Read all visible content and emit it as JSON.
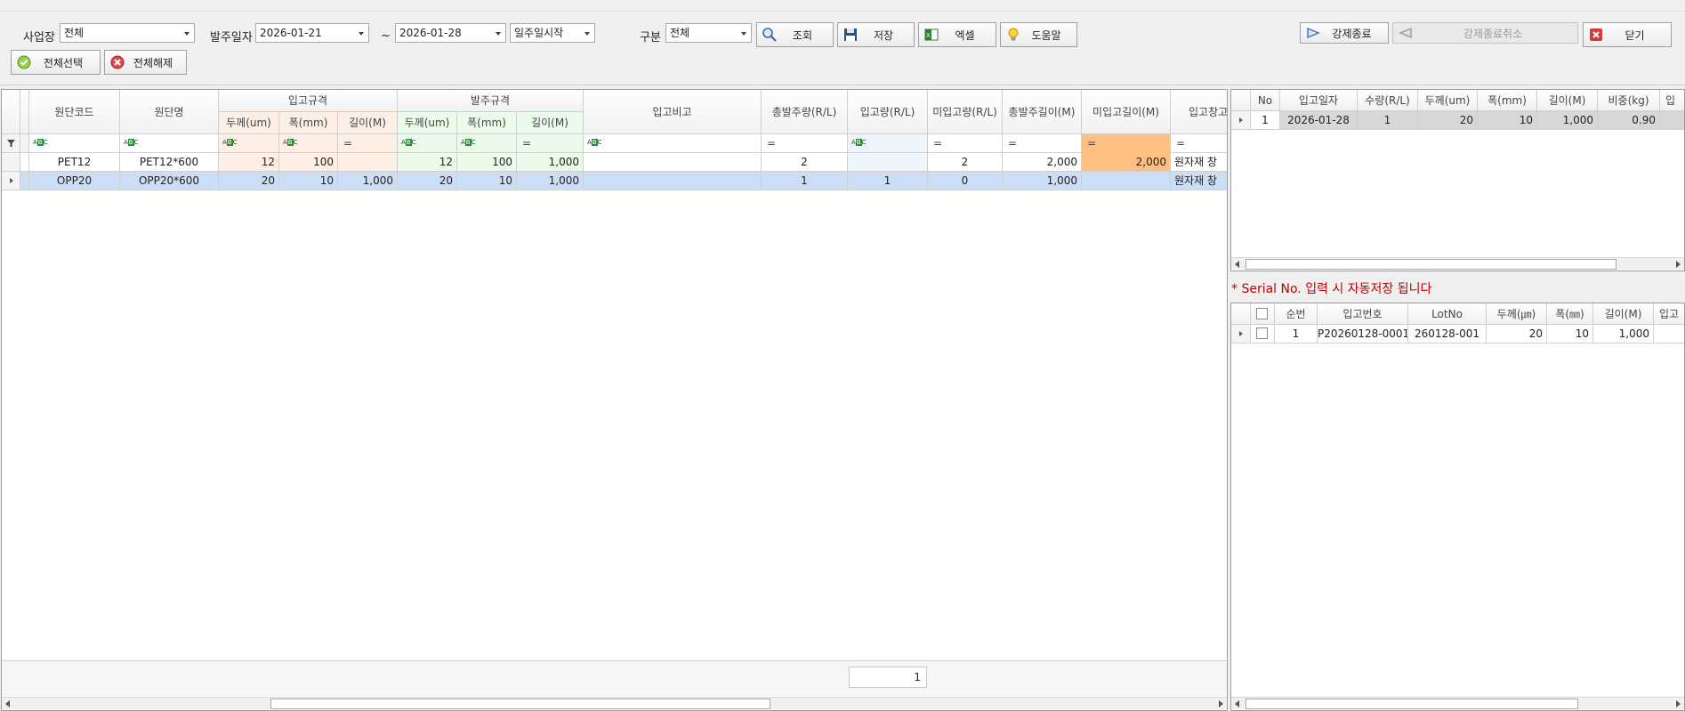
{
  "toolbar": {
    "site_label": "사업장",
    "site_value": "전체",
    "order_date_label": "발주일자",
    "date_from": "2026-01-21",
    "tilde": "~",
    "date_to": "2026-01-28",
    "week_option": "일주일시작",
    "category_label": "구분",
    "category_value": "전체",
    "search_label": "조회",
    "save_label": "저장",
    "excel_label": "엑셀",
    "help_label": "도움말",
    "force_close_label": "강제종료",
    "force_close_cancel_label": "강제종료취소",
    "close_label": "닫기",
    "select_all_label": "전체선택",
    "deselect_all_label": "전체해제"
  },
  "main_grid": {
    "headers": {
      "code": "원단코드",
      "name": "원단명",
      "in_spec": "입고규격",
      "order_spec": "발주규격",
      "thickness": "두께(um)",
      "width": "폭(mm)",
      "length": "길이(M)",
      "remark": "입고비고",
      "total_order_qty": "총발주량(R/L)",
      "in_qty": "입고량(R/L)",
      "not_in_qty": "미입고량(R/L)",
      "total_order_len": "총발주길이(M)",
      "not_in_len": "미입고길이(M)",
      "warehouse": "입고창고"
    },
    "rows": [
      {
        "code": "PET12",
        "name": "PET12*600",
        "in_thk": "12",
        "in_w": "100",
        "in_len": "",
        "ord_thk": "12",
        "ord_w": "100",
        "ord_len": "1,000",
        "remark": "",
        "total_qty": "2",
        "in_qty": "",
        "not_in_qty": "2",
        "total_len": "2,000",
        "not_in_len": "2,000",
        "warehouse": "원자재 창"
      },
      {
        "code": "OPP20",
        "name": "OPP20*600",
        "in_thk": "20",
        "in_w": "10",
        "in_len": "1,000",
        "ord_thk": "20",
        "ord_w": "10",
        "ord_len": "1,000",
        "remark": "",
        "total_qty": "1",
        "in_qty": "1",
        "not_in_qty": "0",
        "total_len": "1,000",
        "not_in_len": "",
        "warehouse": "원자재 창"
      }
    ],
    "footer_count": "1"
  },
  "detail_grid": {
    "headers": {
      "no": "No",
      "in_date": "입고일자",
      "qty": "수량(R/L)",
      "thickness": "두께(um)",
      "width": "폭(mm)",
      "length": "길이(M)",
      "weight": "비중(kg)",
      "extra": "입"
    },
    "rows": [
      {
        "no": "1",
        "in_date": "2026-01-28",
        "qty": "1",
        "thickness": "20",
        "width": "10",
        "length": "1,000",
        "weight": "0.90"
      }
    ]
  },
  "notice": "* Serial No. 입력 시 자동저장 됩니다",
  "serial_grid": {
    "headers": {
      "seq": "순번",
      "in_no": "입고번호",
      "lot": "LotNo",
      "thickness": "두께(㎛)",
      "width": "폭(㎜)",
      "length": "길이(M)",
      "extra": "입고"
    },
    "rows": [
      {
        "seq": "1",
        "in_no": "P20260128-0001",
        "lot": "260128-001",
        "thickness": "20",
        "width": "10",
        "length": "1,000"
      }
    ]
  },
  "colors": {
    "accent_orange": "#ffbf80",
    "spec_in_bg": "#fdefe3",
    "spec_order_bg": "#ebfbe9",
    "selected_row": "#cdddf3",
    "notice_red": "#c00000"
  }
}
